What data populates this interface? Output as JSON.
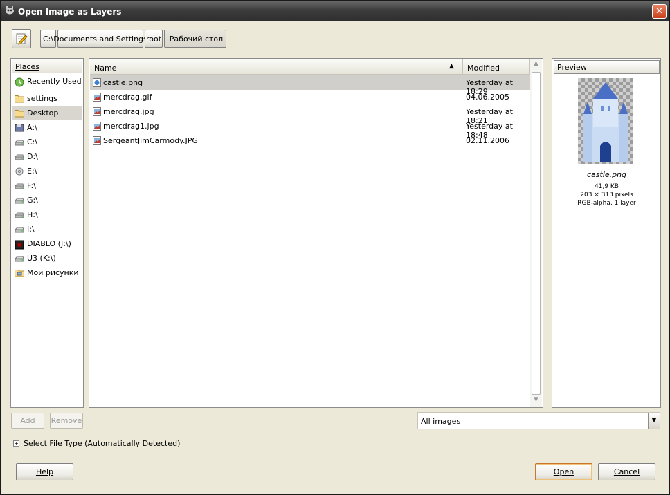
{
  "window": {
    "title": "Open Image as Layers",
    "close_glyph": "✕"
  },
  "toolbar": {
    "edit_location_icon": "pencil-icon"
  },
  "path": {
    "segments": [
      "C:\\",
      "Documents and Settings",
      "root",
      "Рабочий стол"
    ]
  },
  "places": {
    "header": "Places",
    "items": [
      {
        "label": "Recently Used",
        "icon": "recent-icon"
      },
      {
        "label": "settings",
        "icon": "folder-icon"
      },
      {
        "label": "Desktop",
        "icon": "folder-icon",
        "selected": true
      },
      {
        "label": "A:\\",
        "icon": "floppy-icon"
      },
      {
        "label": "C:\\",
        "icon": "drive-icon"
      },
      {
        "label": "D:\\",
        "icon": "drive-icon"
      },
      {
        "label": "E:\\",
        "icon": "cdrom-icon"
      },
      {
        "label": "F:\\",
        "icon": "drive-icon"
      },
      {
        "label": "G:\\",
        "icon": "drive-icon"
      },
      {
        "label": "H:\\",
        "icon": "drive-icon"
      },
      {
        "label": "I:\\",
        "icon": "drive-icon"
      },
      {
        "label": "DIABLO (J:\\)",
        "icon": "game-disc-icon"
      },
      {
        "label": "U3 (K:\\)",
        "icon": "drive-icon"
      },
      {
        "label": "Мои рисунки",
        "icon": "pictures-folder-icon"
      }
    ]
  },
  "files": {
    "columns": {
      "name": "Name",
      "modified": "Modified",
      "sort_glyph": "▲"
    },
    "rows": [
      {
        "name": "castle.png",
        "modified": "Yesterday at 18:29",
        "selected": true
      },
      {
        "name": "mercdrag.gif",
        "modified": "04.06.2005"
      },
      {
        "name": "mercdrag.jpg",
        "modified": "Yesterday at 18:21"
      },
      {
        "name": "mercdrag1.jpg",
        "modified": "Yesterday at 18:48"
      },
      {
        "name": "SergeantJimCarmody.JPG",
        "modified": "02.11.2006"
      }
    ]
  },
  "preview": {
    "header": "Preview",
    "filename": "castle.png",
    "size": "41,9 KB",
    "dimensions": "203 × 313 pixels",
    "mode": "RGB-alpha, 1 layer"
  },
  "actions": {
    "add": "Add",
    "remove": "Remove"
  },
  "filter": {
    "value": "All images",
    "drop_glyph": "▼"
  },
  "file_type": {
    "expander_glyph": "+",
    "label": "Select File Type (Automatically Detected)"
  },
  "buttons": {
    "help": "Help",
    "open": "Open",
    "cancel": "Cancel"
  }
}
